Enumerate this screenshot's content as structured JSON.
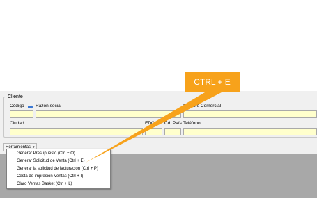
{
  "client": {
    "legend": "Cliente",
    "codigo_label": "Código",
    "razon_social_label": "Razón social",
    "nombre_comercial_label": "Nombre Comercial",
    "ciudad_label": "Ciudad",
    "edo_label": "EDO",
    "cd_pais_label": "Cd. País",
    "telefono_label": "Teléfono",
    "field_color": "#ffffcc"
  },
  "toolbar": {
    "herramientas_label": "Herramientas",
    "chevron_icon": "chevron-down-icon"
  },
  "menu": {
    "items": [
      {
        "label": "Generar Presupuesto (Ctrl + O)"
      },
      {
        "label": "Generar Solicitud de Venta (Ctrl + E)"
      },
      {
        "label": "Generar la solicitud de facturación (Ctrl + P)"
      },
      {
        "label": "Cesta de impresión Ventas (Ctrl + I)"
      },
      {
        "label": "Claro Ventas Basket (Ctrl + L)"
      }
    ]
  },
  "callout": {
    "text": "CTRL + E",
    "color": "#f7a21b"
  },
  "icons": {
    "lookup": "arrow-right-icon"
  }
}
